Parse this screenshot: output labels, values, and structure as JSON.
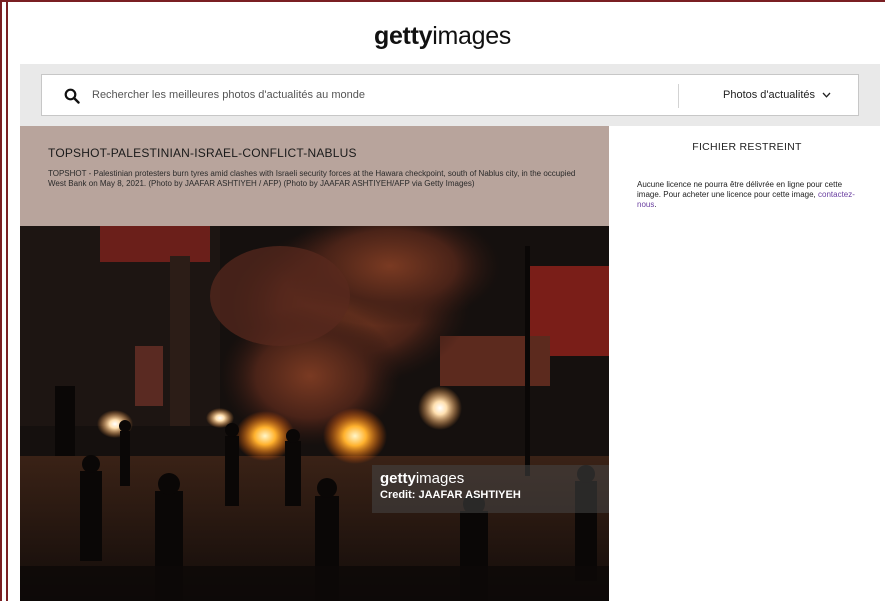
{
  "logo": {
    "bold": "getty",
    "light": "images"
  },
  "search": {
    "placeholder": "Rechercher les meilleures photos d'actualités au monde",
    "category": "Photos d'actualités"
  },
  "photo": {
    "title": "TOPSHOT-PALESTINIAN-ISRAEL-CONFLICT-NABLUS",
    "caption": "TOPSHOT - Palestinian protesters burn tyres amid clashes with Israeli security forces at the Hawara checkpoint, south of Nablus city, in the occupied West Bank on May 8, 2021. (Photo by JAAFAR ASHTIYEH / AFP) (Photo by JAAFAR ASHTIYEH/AFP via Getty Images)",
    "watermark_bold": "getty",
    "watermark_light": "images",
    "credit": "Credit: JAAFAR ASHTIYEH"
  },
  "side": {
    "heading": "FICHIER RESTREINT",
    "licence_text": "Aucune licence ne pourra être délivrée en ligne pour cette image. Pour acheter une licence pour cette image, ",
    "contact_link": "contactez-nous",
    "period": "."
  },
  "colors": {
    "frame": "#7a1f23",
    "caption_bg": "#b8a49c",
    "link": "#6a3fa0",
    "search_band": "#e9e9e9"
  }
}
